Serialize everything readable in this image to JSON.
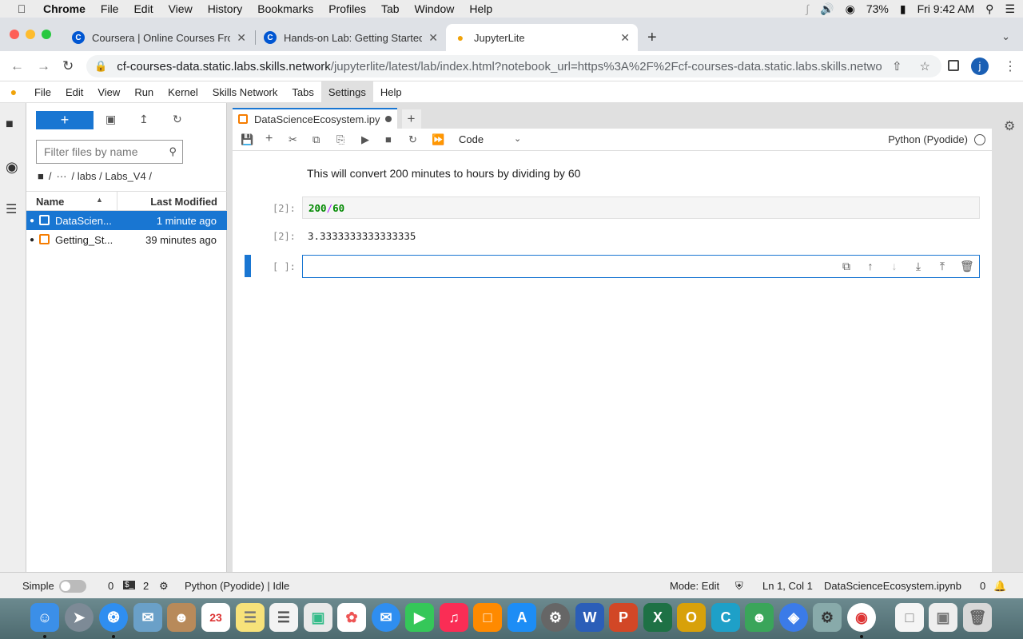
{
  "menubar": {
    "app": "Chrome",
    "items": [
      "File",
      "Edit",
      "View",
      "History",
      "Bookmarks",
      "Profiles",
      "Tab",
      "Window",
      "Help"
    ],
    "battery": "73%",
    "clock": "Fri 9:42 AM"
  },
  "browser": {
    "tabs": [
      {
        "title": "Coursera | Online Courses From",
        "favicon": "C"
      },
      {
        "title": "Hands-on Lab: Getting Started",
        "favicon": "C"
      },
      {
        "title": "JupyterLite",
        "favicon": "lightbulb-icon"
      }
    ],
    "url_host": "cf-courses-data.static.labs.skills.network",
    "url_path": "/jupyterlite/latest/lab/index.html?notebook_url=https%3A%2F%2Fcf-courses-data.static.labs.skills.networ...",
    "profile_initial": "j"
  },
  "jupyter_menu": [
    "File",
    "Edit",
    "View",
    "Run",
    "Kernel",
    "Skills Network",
    "Tabs",
    "Settings",
    "Help"
  ],
  "filebrowser": {
    "filter_placeholder": "Filter files by name",
    "breadcrumb": [
      "/",
      "···",
      "/ labs / Labs_V4 /"
    ],
    "col_name": "Name",
    "col_modified": "Last Modified",
    "files": [
      {
        "name": "DataScien...",
        "modified": "1 minute ago",
        "selected": true
      },
      {
        "name": "Getting_St...",
        "modified": "39 minutes ago",
        "selected": false
      }
    ]
  },
  "notebook": {
    "tab_title": "DataScienceEcosystem.ipy",
    "cell_type": "Code",
    "kernel": "Python (Pyodide)",
    "markdown_text": "This will convert 200 minutes to hours by dividing by 60",
    "cells": [
      {
        "in_prompt": "[2]:",
        "code_num1": "200",
        "code_op": "/",
        "code_num2": "60",
        "out_prompt": "[2]:",
        "output": "3.3333333333333335"
      },
      {
        "in_prompt": "[ ]:"
      }
    ]
  },
  "statusbar": {
    "mode_label": "Simple",
    "terminals": "0",
    "kernels": "2",
    "kernel_status": "Python (Pyodide) | Idle",
    "edit_mode": "Mode: Edit",
    "cursor": "Ln 1, Col 1",
    "filename": "DataScienceEcosystem.ipynb",
    "notifications": "0"
  },
  "colors": {
    "accent": "#1976d2",
    "notebook_icon": "#f57c00"
  }
}
